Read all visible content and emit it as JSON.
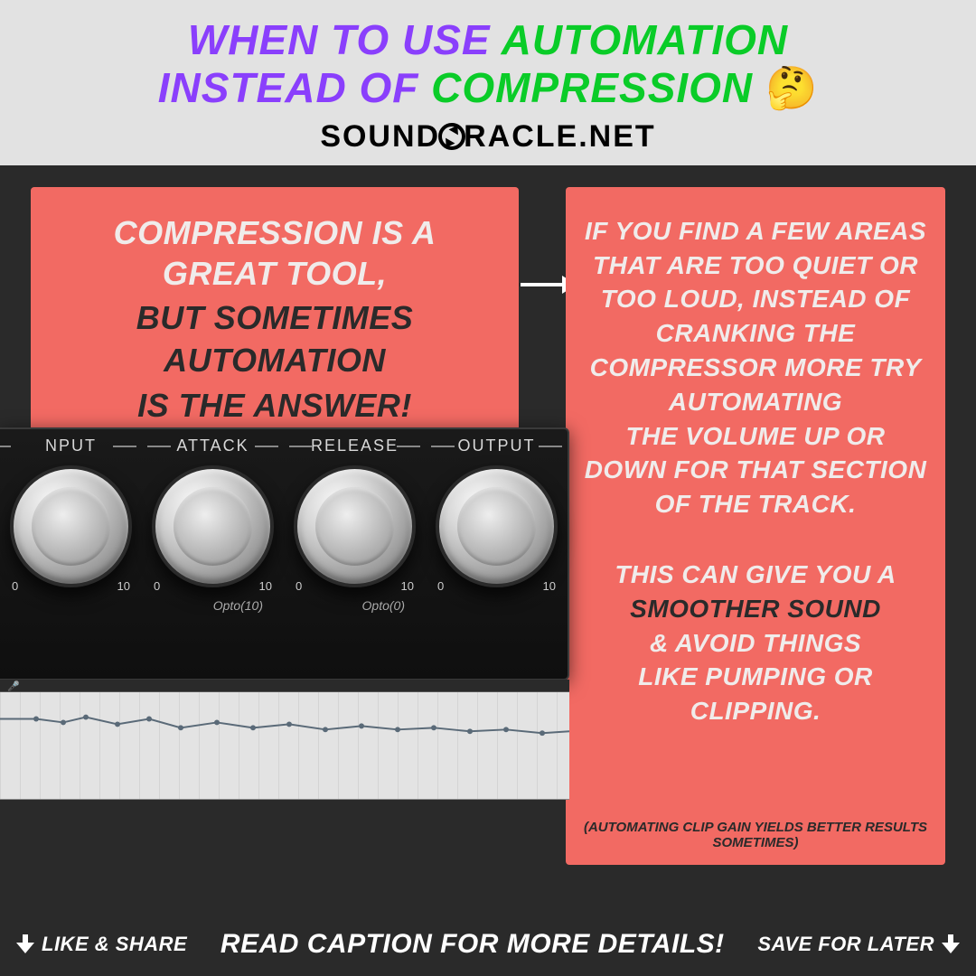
{
  "header": {
    "line1_a": "When to use ",
    "line1_b": "Automation",
    "line2_a": "instead of ",
    "line2_b": "Compression",
    "emoji": "🤔",
    "brand_a": "SOUND",
    "brand_b": "RACLE.NET"
  },
  "left_box": {
    "line1": "Compression is a",
    "line2": "great tool,",
    "line3": "but sometimes automation",
    "line4": "is the answer!"
  },
  "right_box": {
    "p1": "If you find a few areas that are too quiet or too loud, instead of cranking the compressor more try automating",
    "p1b": "the volume up or down for that section of the track.",
    "p2a": "This can give you a",
    "p2b_dark": "smoother sound",
    "p2c": "& avoid things",
    "p2d": "like pumping or clipping.",
    "footnote": "(Automating clip gain yields better results sometimes)"
  },
  "compressor": {
    "labels": [
      "NPUT",
      "ATTACK",
      "RELEASE",
      "OUTPUT"
    ],
    "scale_left": "0",
    "scale_right": "10",
    "sub1": "Opto(10)",
    "sub2": "Opto(0)"
  },
  "footer": {
    "left": "Like & Share",
    "center": "Read caption for more details!",
    "right": "Save for later"
  }
}
